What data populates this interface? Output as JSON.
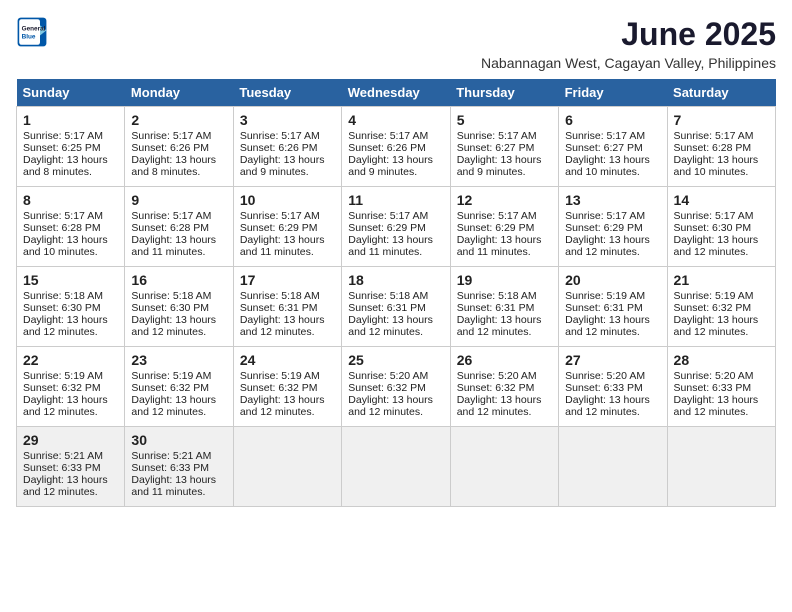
{
  "logo": {
    "line1": "General",
    "line2": "Blue"
  },
  "title": "June 2025",
  "location": "Nabannagan West, Cagayan Valley, Philippines",
  "days_of_week": [
    "Sunday",
    "Monday",
    "Tuesday",
    "Wednesday",
    "Thursday",
    "Friday",
    "Saturday"
  ],
  "weeks": [
    [
      {
        "day": "1",
        "sunrise": "5:17 AM",
        "sunset": "6:25 PM",
        "daylight": "13 hours and 8 minutes."
      },
      {
        "day": "2",
        "sunrise": "5:17 AM",
        "sunset": "6:26 PM",
        "daylight": "13 hours and 8 minutes."
      },
      {
        "day": "3",
        "sunrise": "5:17 AM",
        "sunset": "6:26 PM",
        "daylight": "13 hours and 9 minutes."
      },
      {
        "day": "4",
        "sunrise": "5:17 AM",
        "sunset": "6:26 PM",
        "daylight": "13 hours and 9 minutes."
      },
      {
        "day": "5",
        "sunrise": "5:17 AM",
        "sunset": "6:27 PM",
        "daylight": "13 hours and 9 minutes."
      },
      {
        "day": "6",
        "sunrise": "5:17 AM",
        "sunset": "6:27 PM",
        "daylight": "13 hours and 10 minutes."
      },
      {
        "day": "7",
        "sunrise": "5:17 AM",
        "sunset": "6:28 PM",
        "daylight": "13 hours and 10 minutes."
      }
    ],
    [
      {
        "day": "8",
        "sunrise": "5:17 AM",
        "sunset": "6:28 PM",
        "daylight": "13 hours and 10 minutes."
      },
      {
        "day": "9",
        "sunrise": "5:17 AM",
        "sunset": "6:28 PM",
        "daylight": "13 hours and 11 minutes."
      },
      {
        "day": "10",
        "sunrise": "5:17 AM",
        "sunset": "6:29 PM",
        "daylight": "13 hours and 11 minutes."
      },
      {
        "day": "11",
        "sunrise": "5:17 AM",
        "sunset": "6:29 PM",
        "daylight": "13 hours and 11 minutes."
      },
      {
        "day": "12",
        "sunrise": "5:17 AM",
        "sunset": "6:29 PM",
        "daylight": "13 hours and 11 minutes."
      },
      {
        "day": "13",
        "sunrise": "5:17 AM",
        "sunset": "6:29 PM",
        "daylight": "13 hours and 12 minutes."
      },
      {
        "day": "14",
        "sunrise": "5:17 AM",
        "sunset": "6:30 PM",
        "daylight": "13 hours and 12 minutes."
      }
    ],
    [
      {
        "day": "15",
        "sunrise": "5:18 AM",
        "sunset": "6:30 PM",
        "daylight": "13 hours and 12 minutes."
      },
      {
        "day": "16",
        "sunrise": "5:18 AM",
        "sunset": "6:30 PM",
        "daylight": "13 hours and 12 minutes."
      },
      {
        "day": "17",
        "sunrise": "5:18 AM",
        "sunset": "6:31 PM",
        "daylight": "13 hours and 12 minutes."
      },
      {
        "day": "18",
        "sunrise": "5:18 AM",
        "sunset": "6:31 PM",
        "daylight": "13 hours and 12 minutes."
      },
      {
        "day": "19",
        "sunrise": "5:18 AM",
        "sunset": "6:31 PM",
        "daylight": "13 hours and 12 minutes."
      },
      {
        "day": "20",
        "sunrise": "5:19 AM",
        "sunset": "6:31 PM",
        "daylight": "13 hours and 12 minutes."
      },
      {
        "day": "21",
        "sunrise": "5:19 AM",
        "sunset": "6:32 PM",
        "daylight": "13 hours and 12 minutes."
      }
    ],
    [
      {
        "day": "22",
        "sunrise": "5:19 AM",
        "sunset": "6:32 PM",
        "daylight": "13 hours and 12 minutes."
      },
      {
        "day": "23",
        "sunrise": "5:19 AM",
        "sunset": "6:32 PM",
        "daylight": "13 hours and 12 minutes."
      },
      {
        "day": "24",
        "sunrise": "5:19 AM",
        "sunset": "6:32 PM",
        "daylight": "13 hours and 12 minutes."
      },
      {
        "day": "25",
        "sunrise": "5:20 AM",
        "sunset": "6:32 PM",
        "daylight": "13 hours and 12 minutes."
      },
      {
        "day": "26",
        "sunrise": "5:20 AM",
        "sunset": "6:32 PM",
        "daylight": "13 hours and 12 minutes."
      },
      {
        "day": "27",
        "sunrise": "5:20 AM",
        "sunset": "6:33 PM",
        "daylight": "13 hours and 12 minutes."
      },
      {
        "day": "28",
        "sunrise": "5:20 AM",
        "sunset": "6:33 PM",
        "daylight": "13 hours and 12 minutes."
      }
    ],
    [
      {
        "day": "29",
        "sunrise": "5:21 AM",
        "sunset": "6:33 PM",
        "daylight": "13 hours and 12 minutes."
      },
      {
        "day": "30",
        "sunrise": "5:21 AM",
        "sunset": "6:33 PM",
        "daylight": "13 hours and 11 minutes."
      },
      null,
      null,
      null,
      null,
      null
    ]
  ]
}
